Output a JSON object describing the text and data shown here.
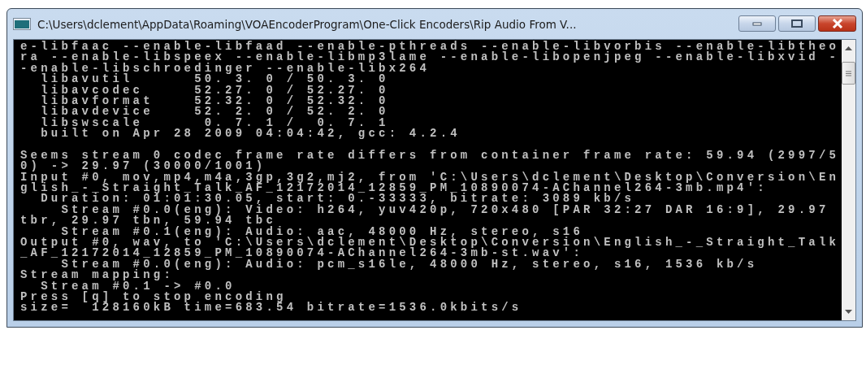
{
  "window": {
    "title": "C:\\Users\\dclement\\AppData\\Roaming\\VOAEncoderProgram\\One-Click Encoders\\Rip Audio From V..."
  },
  "console": {
    "lines": [
      {
        "text": "e-libfaac --enable-libfaad --enable-pthreads --enable-libvorbis --enable-libtheo",
        "gap_before": false
      },
      {
        "text": "ra --enable-libspeex --enable-libmp3lame --enable-libopenjpeg --enable-libxvid -",
        "gap_before": false
      },
      {
        "text": "-enable-libschroedinger --enable-libx264",
        "gap_before": false
      },
      {
        "text": "  libavutil      50. 3. 0 / 50. 3. 0",
        "gap_before": false
      },
      {
        "text": "  libavcodec     52.27. 0 / 52.27. 0",
        "gap_before": false
      },
      {
        "text": "  libavformat    52.32. 0 / 52.32. 0",
        "gap_before": false
      },
      {
        "text": "  libavdevice    52. 2. 0 / 52. 2. 0",
        "gap_before": false
      },
      {
        "text": "  libswscale      0. 7. 1 /  0. 7. 1",
        "gap_before": false
      },
      {
        "text": "  built on Apr 28 2009 04:04:42, gcc: 4.2.4",
        "gap_before": false
      },
      {
        "text": "Seems stream 0 codec frame rate differs from container frame rate: 59.94 (2997/5",
        "gap_before": true
      },
      {
        "text": "0) -> 29.97 (30000/1001)",
        "gap_before": false
      },
      {
        "text": "Input #0, mov,mp4,m4a,3gp,3g2,mj2, from 'C:\\Users\\dclement\\Desktop\\Conversion\\En",
        "gap_before": false
      },
      {
        "text": "glish_-_Straight_Talk_AF_12172014_12859_PM_10890074-AChannel264-3mb.mp4':",
        "gap_before": false
      },
      {
        "text": "  Duration: 01:01:30.05, start: 0.-33333, bitrate: 3089 kb/s",
        "gap_before": false
      },
      {
        "text": "    Stream #0.0(eng): Video: h264, yuv420p, 720x480 [PAR 32:27 DAR 16:9], 29.97",
        "gap_before": false
      },
      {
        "text": "tbr, 29.97 tbn, 59.94 tbc",
        "gap_before": false
      },
      {
        "text": "    Stream #0.1(eng): Audio: aac, 48000 Hz, stereo, s16",
        "gap_before": false
      },
      {
        "text": "Output #0, wav, to 'C:\\Users\\dclement\\Desktop\\Conversion\\English_-_Straight_Talk",
        "gap_before": false
      },
      {
        "text": "_AF_12172014_12859_PM_10890074-AChannel264-3mb-st.wav':",
        "gap_before": false
      },
      {
        "text": "    Stream #0.0(eng): Audio: pcm_s16le, 48000 Hz, stereo, s16, 1536 kb/s",
        "gap_before": false
      },
      {
        "text": "Stream mapping:",
        "gap_before": false
      },
      {
        "text": "  Stream #0.1 -> #0.0",
        "gap_before": false
      },
      {
        "text": "Press [q] to stop encoding",
        "gap_before": false
      },
      {
        "text": "size=  128160kB time=683.54 bitrate=1536.0kbits/s",
        "gap_before": false
      }
    ]
  }
}
